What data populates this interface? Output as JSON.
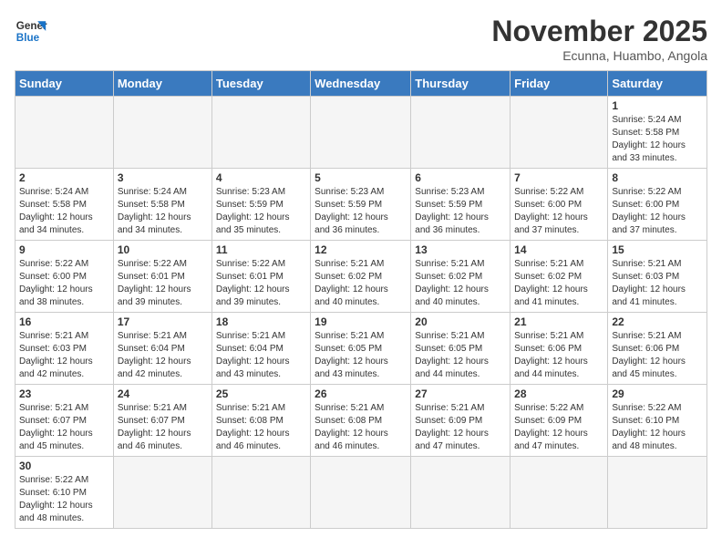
{
  "logo": {
    "text_general": "General",
    "text_blue": "Blue"
  },
  "header": {
    "month": "November 2025",
    "location": "Ecunna, Huambo, Angola"
  },
  "weekdays": [
    "Sunday",
    "Monday",
    "Tuesday",
    "Wednesday",
    "Thursday",
    "Friday",
    "Saturday"
  ],
  "weeks": [
    [
      {
        "day": "",
        "info": ""
      },
      {
        "day": "",
        "info": ""
      },
      {
        "day": "",
        "info": ""
      },
      {
        "day": "",
        "info": ""
      },
      {
        "day": "",
        "info": ""
      },
      {
        "day": "",
        "info": ""
      },
      {
        "day": "1",
        "info": "Sunrise: 5:24 AM\nSunset: 5:58 PM\nDaylight: 12 hours\nand 33 minutes."
      }
    ],
    [
      {
        "day": "2",
        "info": "Sunrise: 5:24 AM\nSunset: 5:58 PM\nDaylight: 12 hours\nand 34 minutes."
      },
      {
        "day": "3",
        "info": "Sunrise: 5:24 AM\nSunset: 5:58 PM\nDaylight: 12 hours\nand 34 minutes."
      },
      {
        "day": "4",
        "info": "Sunrise: 5:23 AM\nSunset: 5:59 PM\nDaylight: 12 hours\nand 35 minutes."
      },
      {
        "day": "5",
        "info": "Sunrise: 5:23 AM\nSunset: 5:59 PM\nDaylight: 12 hours\nand 36 minutes."
      },
      {
        "day": "6",
        "info": "Sunrise: 5:23 AM\nSunset: 5:59 PM\nDaylight: 12 hours\nand 36 minutes."
      },
      {
        "day": "7",
        "info": "Sunrise: 5:22 AM\nSunset: 6:00 PM\nDaylight: 12 hours\nand 37 minutes."
      },
      {
        "day": "8",
        "info": "Sunrise: 5:22 AM\nSunset: 6:00 PM\nDaylight: 12 hours\nand 37 minutes."
      }
    ],
    [
      {
        "day": "9",
        "info": "Sunrise: 5:22 AM\nSunset: 6:00 PM\nDaylight: 12 hours\nand 38 minutes."
      },
      {
        "day": "10",
        "info": "Sunrise: 5:22 AM\nSunset: 6:01 PM\nDaylight: 12 hours\nand 39 minutes."
      },
      {
        "day": "11",
        "info": "Sunrise: 5:22 AM\nSunset: 6:01 PM\nDaylight: 12 hours\nand 39 minutes."
      },
      {
        "day": "12",
        "info": "Sunrise: 5:21 AM\nSunset: 6:02 PM\nDaylight: 12 hours\nand 40 minutes."
      },
      {
        "day": "13",
        "info": "Sunrise: 5:21 AM\nSunset: 6:02 PM\nDaylight: 12 hours\nand 40 minutes."
      },
      {
        "day": "14",
        "info": "Sunrise: 5:21 AM\nSunset: 6:02 PM\nDaylight: 12 hours\nand 41 minutes."
      },
      {
        "day": "15",
        "info": "Sunrise: 5:21 AM\nSunset: 6:03 PM\nDaylight: 12 hours\nand 41 minutes."
      }
    ],
    [
      {
        "day": "16",
        "info": "Sunrise: 5:21 AM\nSunset: 6:03 PM\nDaylight: 12 hours\nand 42 minutes."
      },
      {
        "day": "17",
        "info": "Sunrise: 5:21 AM\nSunset: 6:04 PM\nDaylight: 12 hours\nand 42 minutes."
      },
      {
        "day": "18",
        "info": "Sunrise: 5:21 AM\nSunset: 6:04 PM\nDaylight: 12 hours\nand 43 minutes."
      },
      {
        "day": "19",
        "info": "Sunrise: 5:21 AM\nSunset: 6:05 PM\nDaylight: 12 hours\nand 43 minutes."
      },
      {
        "day": "20",
        "info": "Sunrise: 5:21 AM\nSunset: 6:05 PM\nDaylight: 12 hours\nand 44 minutes."
      },
      {
        "day": "21",
        "info": "Sunrise: 5:21 AM\nSunset: 6:06 PM\nDaylight: 12 hours\nand 44 minutes."
      },
      {
        "day": "22",
        "info": "Sunrise: 5:21 AM\nSunset: 6:06 PM\nDaylight: 12 hours\nand 45 minutes."
      }
    ],
    [
      {
        "day": "23",
        "info": "Sunrise: 5:21 AM\nSunset: 6:07 PM\nDaylight: 12 hours\nand 45 minutes."
      },
      {
        "day": "24",
        "info": "Sunrise: 5:21 AM\nSunset: 6:07 PM\nDaylight: 12 hours\nand 46 minutes."
      },
      {
        "day": "25",
        "info": "Sunrise: 5:21 AM\nSunset: 6:08 PM\nDaylight: 12 hours\nand 46 minutes."
      },
      {
        "day": "26",
        "info": "Sunrise: 5:21 AM\nSunset: 6:08 PM\nDaylight: 12 hours\nand 46 minutes."
      },
      {
        "day": "27",
        "info": "Sunrise: 5:21 AM\nSunset: 6:09 PM\nDaylight: 12 hours\nand 47 minutes."
      },
      {
        "day": "28",
        "info": "Sunrise: 5:22 AM\nSunset: 6:09 PM\nDaylight: 12 hours\nand 47 minutes."
      },
      {
        "day": "29",
        "info": "Sunrise: 5:22 AM\nSunset: 6:10 PM\nDaylight: 12 hours\nand 48 minutes."
      }
    ],
    [
      {
        "day": "30",
        "info": "Sunrise: 5:22 AM\nSunset: 6:10 PM\nDaylight: 12 hours\nand 48 minutes."
      },
      {
        "day": "",
        "info": ""
      },
      {
        "day": "",
        "info": ""
      },
      {
        "day": "",
        "info": ""
      },
      {
        "day": "",
        "info": ""
      },
      {
        "day": "",
        "info": ""
      },
      {
        "day": "",
        "info": ""
      }
    ]
  ]
}
